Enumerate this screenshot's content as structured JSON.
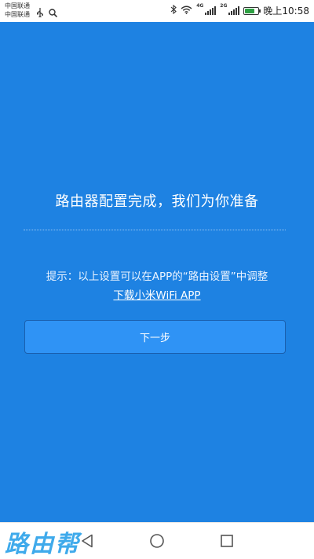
{
  "status_bar": {
    "carrier_1": "中国联通",
    "carrier_2": "中国联通",
    "net_1": "4G",
    "net_2": "2G",
    "time": "晚上10:58",
    "battery_level": 0.75,
    "icons": [
      "usb-icon",
      "search-icon",
      "bluetooth-icon",
      "wifi-icon",
      "signal-icon",
      "battery-icon"
    ]
  },
  "main": {
    "headline": "路由器配置完成，我们为你准备",
    "hint": "提示：以上设置可以在APP的“路由设置”中调整",
    "app_link": "下载小米WiFi APP",
    "next_button": "下一步",
    "background_color": "#1e82e2",
    "button_color": "#2f93f5"
  },
  "nav_bar": {
    "buttons": [
      "back-icon",
      "home-icon",
      "recents-icon"
    ],
    "watermark": "路由帮"
  }
}
